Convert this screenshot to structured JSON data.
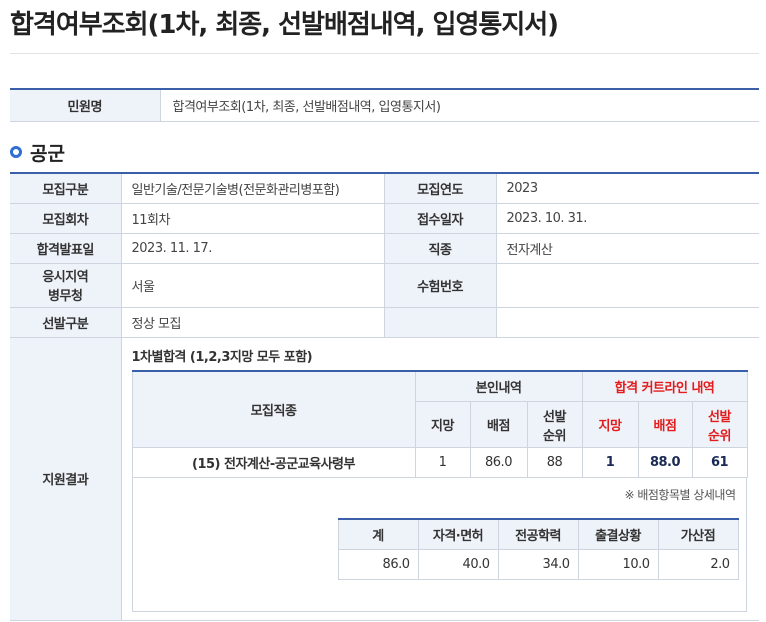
{
  "page": {
    "title": "합격여부조회(1차, 최종, 선발배점내역, 입영통지서)"
  },
  "civil": {
    "label": "민원명",
    "value": "합격여부조회(1차, 최종, 선발배점내역, 입영통지서)"
  },
  "section": {
    "title": "공군"
  },
  "info": {
    "recruit_type_label": "모집구분",
    "recruit_type": "일반기술/전문기술병(전문화관리병포함)",
    "recruit_year_label": "모집연도",
    "recruit_year": "2023",
    "round_label": "모집회차",
    "round": "11회차",
    "apply_date_label": "접수일자",
    "apply_date": "2023. 10. 31.",
    "announce_date_label": "합격발표일",
    "announce_date": "2023. 11. 17.",
    "job_label": "직종",
    "job": "전자계산",
    "region_label_1": "응시지역",
    "region_label_2": "병무청",
    "region": "서울",
    "exam_no_label": "수험번호",
    "exam_no": "",
    "selection_label": "선발구분",
    "selection": "정상 모집",
    "result_label": "지원결과"
  },
  "result": {
    "subtitle": "1차별합격 (1,2,3지망 모두 포함)",
    "col_job": "모집직종",
    "col_mine": "본인내역",
    "col_cutline": "합격 커트라인 내역",
    "col_choice": "지망",
    "col_score": "배점",
    "col_rank_1": "선발",
    "col_rank_2": "순위",
    "row": {
      "job": "(15) 전자계산-공군교육사령부",
      "my_choice": "1",
      "my_score": "86.0",
      "my_rank": "88",
      "cut_choice": "1",
      "cut_score": "88.0",
      "cut_rank": "61"
    },
    "note": "※ 배점항목별 상세내역"
  },
  "scores": {
    "headers": [
      "계",
      "자격·면허",
      "전공학력",
      "출결상황",
      "가산점"
    ],
    "values": [
      "86.0",
      "40.0",
      "34.0",
      "10.0",
      "2.0"
    ]
  },
  "colors": {
    "accent": "#3a5ea8",
    "label_bg": "#eef2f9",
    "cutline_red": "#e21b1b",
    "bullet_blue": "#2f6fd6"
  }
}
